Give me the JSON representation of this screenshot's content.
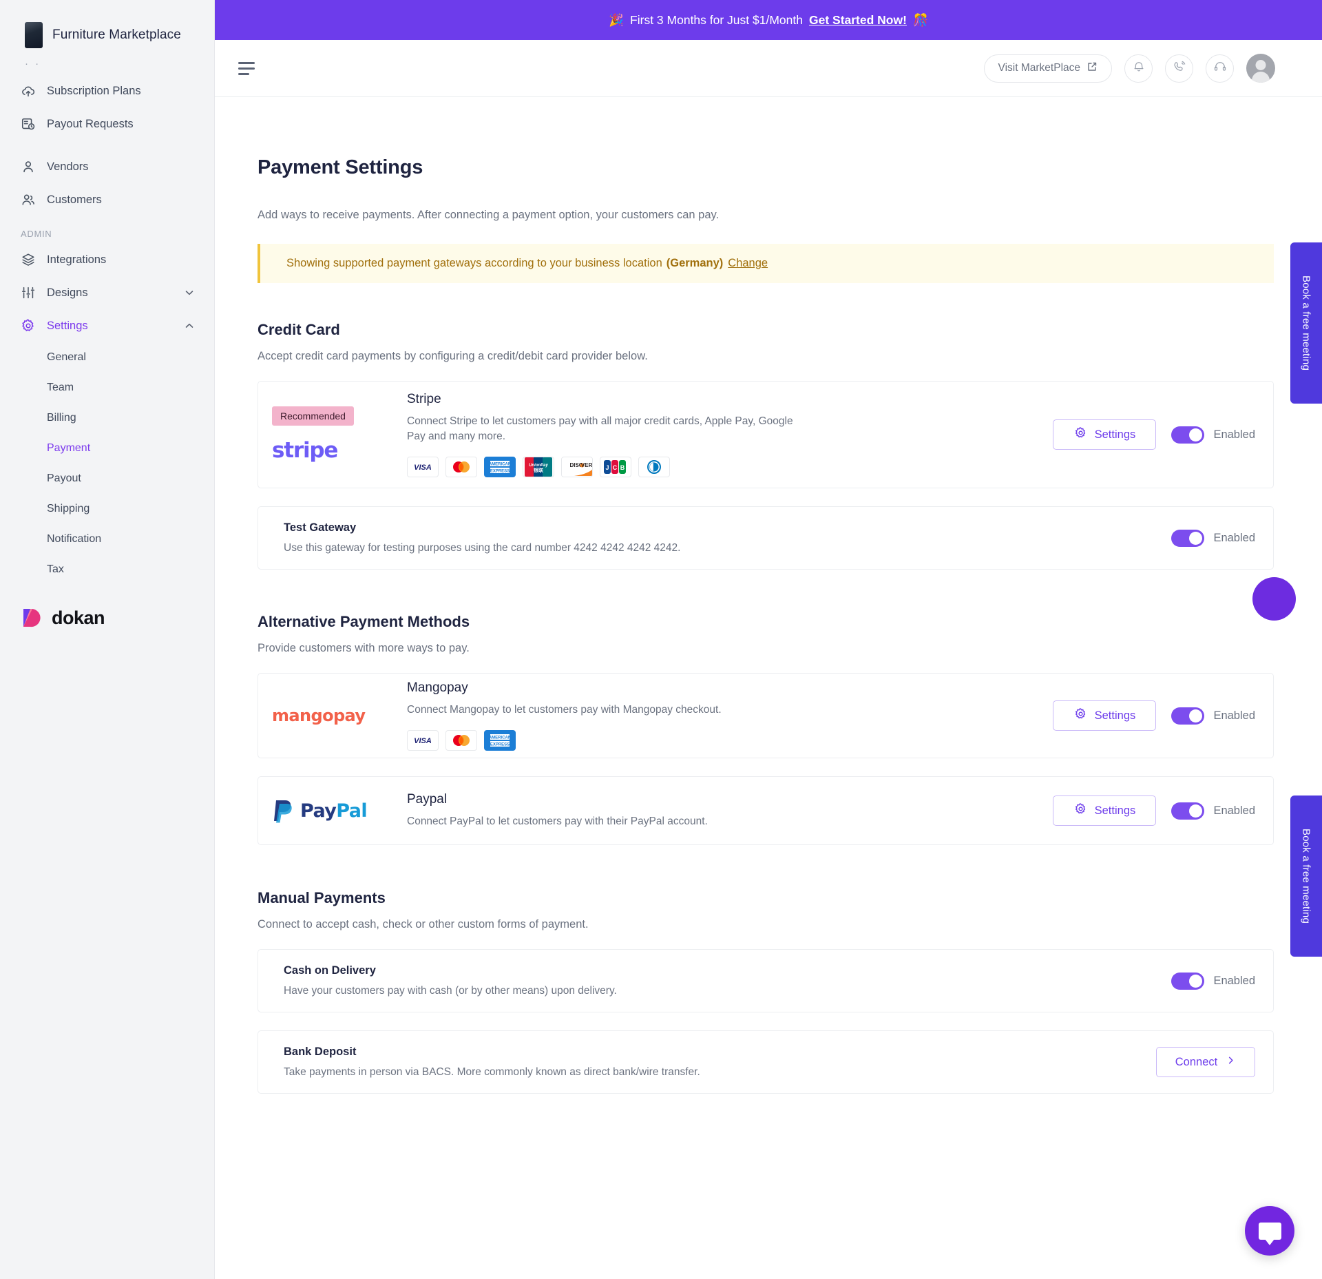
{
  "promo": {
    "emoji_left": "🎉",
    "text": "First 3 Months for Just $1/Month",
    "link": "Get Started Now!",
    "emoji_right": "🎊"
  },
  "sidebar": {
    "brand": "Furniture Marketplace",
    "dots": "· ·",
    "items": [
      {
        "label": "Subscription Plans",
        "icon": "cloud-upload-icon",
        "active": false
      },
      {
        "label": "Payout Requests",
        "icon": "receipt-clock-icon",
        "active": false
      },
      {
        "label": "Vendors",
        "icon": "user-icon",
        "active": false
      },
      {
        "label": "Customers",
        "icon": "users-icon",
        "active": false
      }
    ],
    "section_label": "ADMIN",
    "admin_items": [
      {
        "label": "Integrations",
        "icon": "layers-icon",
        "caret": "none",
        "active": false
      },
      {
        "label": "Designs",
        "icon": "sliders-icon",
        "caret": "down",
        "active": false
      },
      {
        "label": "Settings",
        "icon": "gear-icon",
        "caret": "up",
        "active": true
      }
    ],
    "settings_children": [
      {
        "label": "General",
        "active": false
      },
      {
        "label": "Team",
        "active": false
      },
      {
        "label": "Billing",
        "active": false
      },
      {
        "label": "Payment",
        "active": true
      },
      {
        "label": "Payout",
        "active": false
      },
      {
        "label": "Shipping",
        "active": false
      },
      {
        "label": "Notification",
        "active": false
      },
      {
        "label": "Tax",
        "active": false
      }
    ],
    "footer_logo_text": "dokan"
  },
  "header": {
    "visit_marketplace": "Visit MarketPlace",
    "icons": [
      "bell-icon",
      "phone-ring-icon",
      "headset-icon",
      "avatar"
    ]
  },
  "page": {
    "title": "Payment Settings",
    "subtitle": "Add ways to receive payments. After connecting a payment option, your customers can pay.",
    "notice": {
      "text": "Showing supported payment gateways according to your business location",
      "location": "(Germany)",
      "link": "Change"
    }
  },
  "sections": {
    "credit_card": {
      "title": "Credit Card",
      "description": "Accept credit card payments by configuring a credit/debit card provider below."
    },
    "alternative": {
      "title": "Alternative Payment Methods",
      "description": "Provide customers with more ways to pay."
    },
    "manual": {
      "title": "Manual Payments",
      "description": "Connect to accept cash, check or other custom forms of payment."
    }
  },
  "gateways": {
    "stripe": {
      "badge": "Recommended",
      "logo_text": "stripe",
      "name": "Stripe",
      "description": "Connect Stripe to let customers pay with all major credit cards, Apple Pay, Google Pay and many more.",
      "brands": [
        "visa",
        "mastercard",
        "amex",
        "unionpay",
        "discover",
        "jcb",
        "diners"
      ],
      "settings_label": "Settings",
      "toggle_label": "Enabled",
      "enabled": true
    },
    "test_gateway": {
      "name": "Test Gateway",
      "description": "Use this gateway for testing purposes using the card number 4242 4242 4242 4242.",
      "toggle_label": "Enabled",
      "enabled": true
    },
    "mangopay": {
      "logo_text": "mangopay",
      "name": "Mangopay",
      "description": "Connect Mangopay to let customers pay with Mangopay checkout.",
      "brands": [
        "visa",
        "mastercard",
        "amex"
      ],
      "settings_label": "Settings",
      "toggle_label": "Enabled",
      "enabled": true
    },
    "paypal": {
      "logo_text_1": "Pay",
      "logo_text_2": "Pal",
      "name": "Paypal",
      "description": "Connect PayPal to let customers pay with their PayPal account.",
      "settings_label": "Settings",
      "toggle_label": "Enabled",
      "enabled": true
    },
    "cash_on_delivery": {
      "name": "Cash on Delivery",
      "description": "Have your customers pay with cash (or by other means) upon delivery.",
      "toggle_label": "Enabled",
      "enabled": true
    },
    "bank_deposit": {
      "name": "Bank Deposit",
      "description": "Take payments in person via BACS. More commonly known as direct bank/wire transfer.",
      "connect_label": "Connect"
    }
  },
  "floating": {
    "side_tab_1": "Book a free meeting",
    "side_tab_2": "Book a free meeting"
  },
  "colors": {
    "brand_purple": "#6d3ceb",
    "accent_violet": "#7c4dee",
    "notice_bg": "#fefbe9",
    "notice_border": "#f0c43c",
    "notice_text": "#a1700d",
    "badge_pink": "#f3b3cb"
  }
}
